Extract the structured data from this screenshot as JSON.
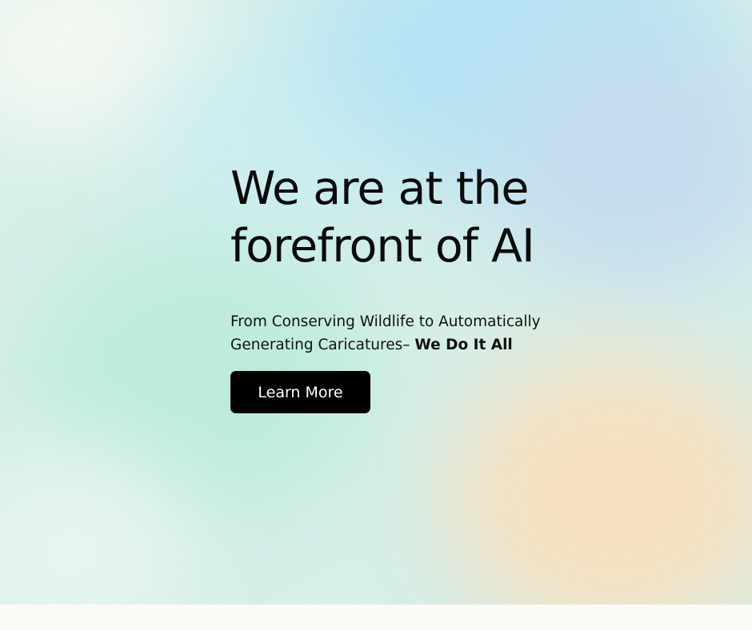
{
  "hero": {
    "headline_line1": "We are at the",
    "headline_line2": "forefront of AI",
    "subtitle_regular": "From Conserving Wildlife to Automatically Generating Caricatures– ",
    "subtitle_bold": "We Do It All",
    "cta_label": "Learn More"
  },
  "colors": {
    "button_background": "#000000",
    "button_text": "#ffffff",
    "text": "#0b0b0b",
    "page_background": "#fbfaf6"
  }
}
